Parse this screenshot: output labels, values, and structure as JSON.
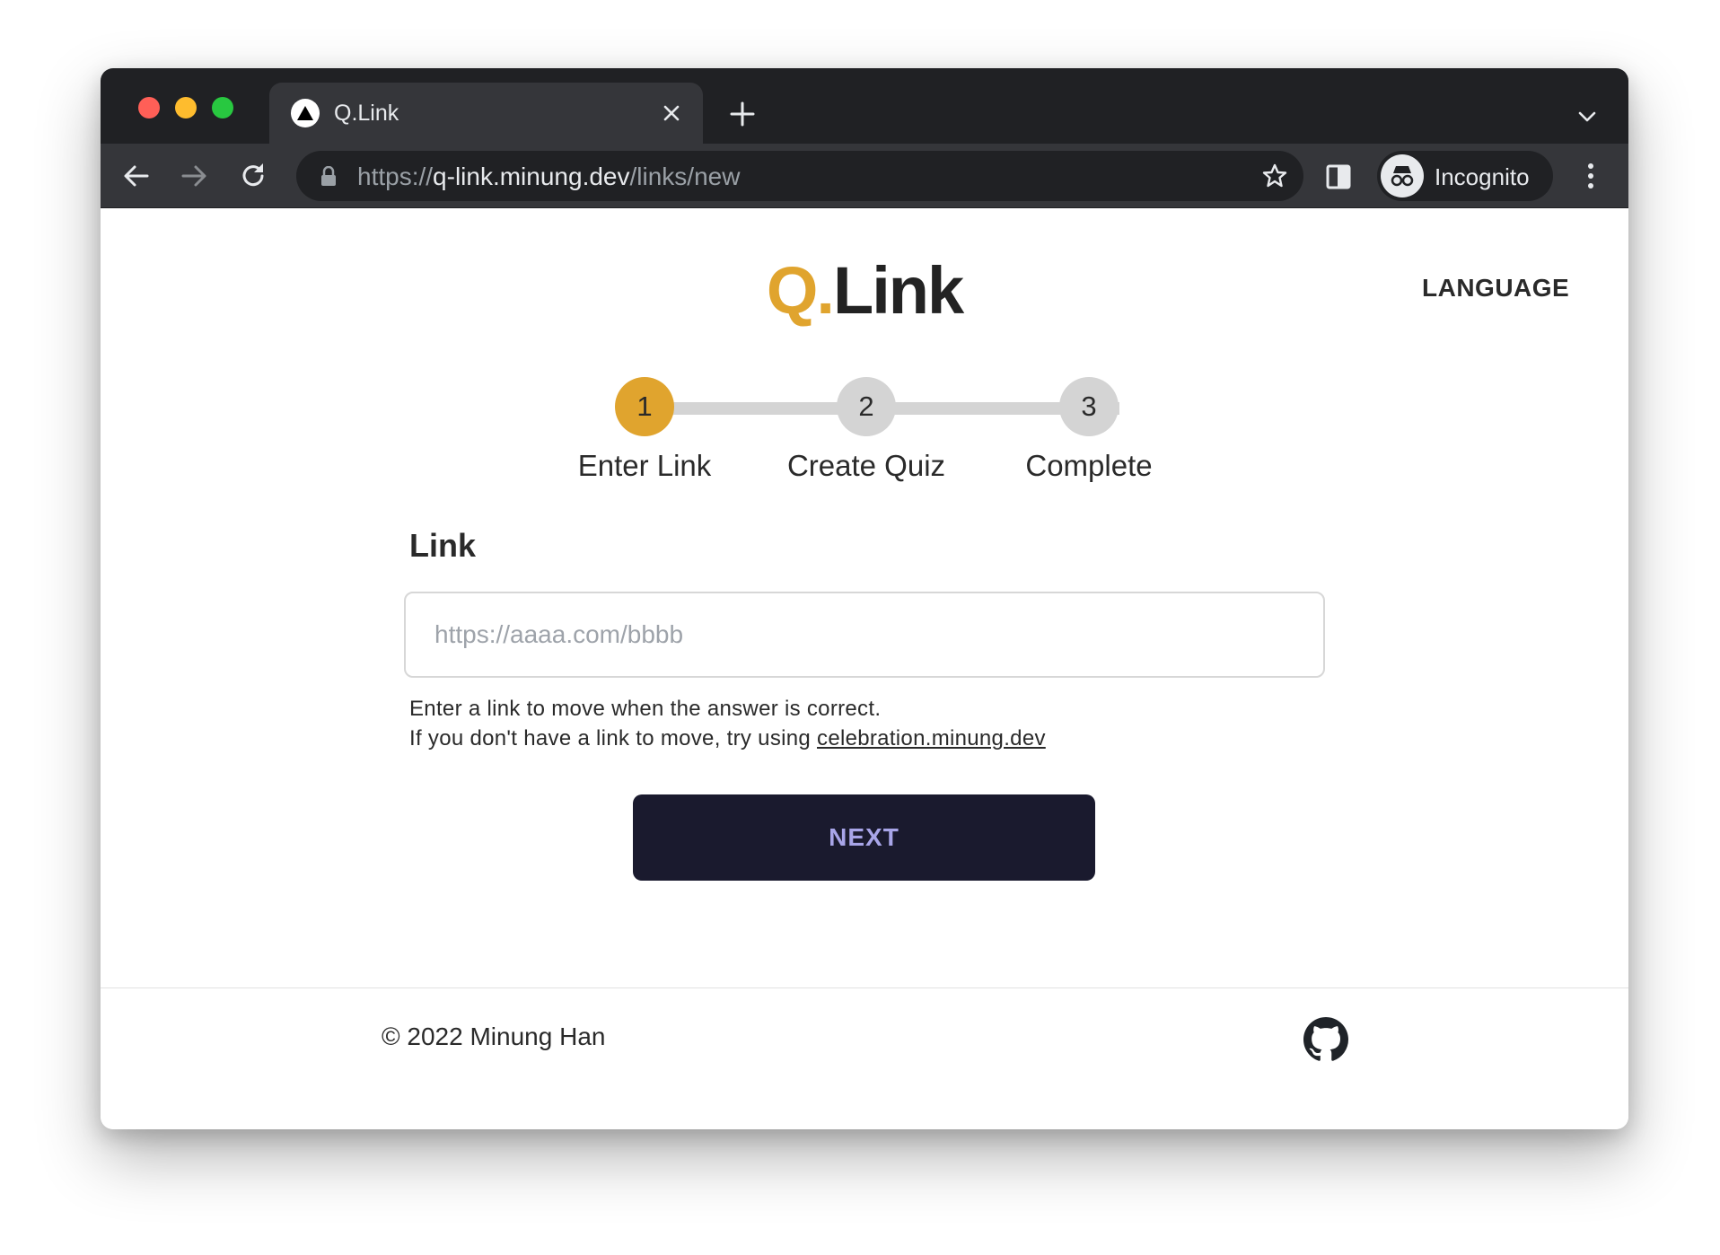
{
  "browser": {
    "tab_title": "Q.Link",
    "url": {
      "scheme": "https://",
      "host": "q-link.minung.dev",
      "path": "/links/new"
    },
    "profile_label": "Incognito"
  },
  "header": {
    "logo_accent": "Q.",
    "logo_main": "Link",
    "language_label": "LANGUAGE"
  },
  "stepper": {
    "steps": [
      {
        "number": "1",
        "label": "Enter Link"
      },
      {
        "number": "2",
        "label": "Create Quiz"
      },
      {
        "number": "3",
        "label": "Complete"
      }
    ],
    "active_step": 1
  },
  "form": {
    "label": "Link",
    "placeholder": "https://aaaa.com/bbbb",
    "value": "",
    "helper_line1": "Enter a link to move when the answer is correct.",
    "helper_line2_prefix": "If you don't have a link to move, try using ",
    "helper_link": "celebration.minung.dev",
    "next_label": "NEXT"
  },
  "footer": {
    "copyright": "© 2022 Minung Han"
  },
  "colors": {
    "accent": "#e0a42e",
    "button_bg": "#1a1a2e",
    "button_text": "#a8a5e8",
    "text": "#2a2a2a"
  },
  "icons": [
    "vercel-favicon-icon",
    "close-icon",
    "plus-icon",
    "chevron-down-icon",
    "back-arrow-icon",
    "forward-arrow-icon",
    "reload-icon",
    "lock-icon",
    "star-icon",
    "side-panel-icon",
    "incognito-icon",
    "more-vert-icon",
    "github-icon"
  ]
}
